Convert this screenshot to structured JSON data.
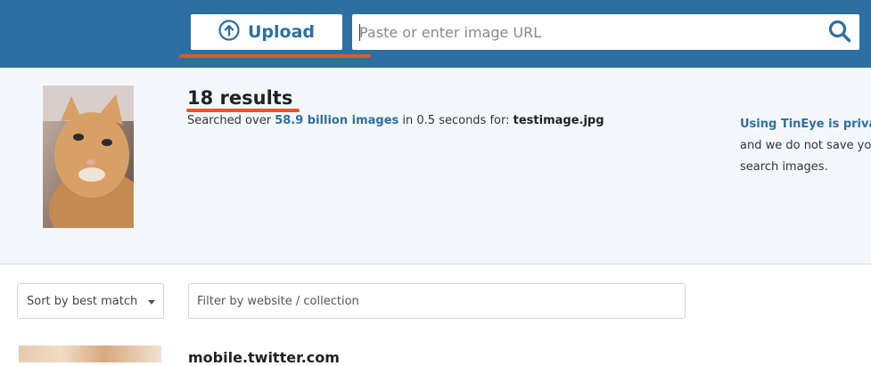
{
  "header": {
    "upload_label": "Upload",
    "search_placeholder": "Paste or enter image URL",
    "search_value": "",
    "colors": {
      "header_bg": "#2e6fa2",
      "accent_underline": "#e8571f"
    }
  },
  "summary": {
    "results_count": "18 results",
    "searched_prefix": "Searched over",
    "searched_link": "58.9 billion images",
    "searched_mid": "in 0.5 seconds for:",
    "filename": "testimage.jpg",
    "privacy_link": "Using TinEye is private",
    "privacy_line2": "and we do not save you",
    "privacy_line3": "search images."
  },
  "controls": {
    "sort_selected": "Sort by best match",
    "filter_placeholder": "Filter by website / collection"
  },
  "results": [
    {
      "domain": "mobile.twitter.com"
    }
  ],
  "icons": {
    "upload": "upload-arrow-circle-icon",
    "search": "search-icon",
    "sort_chevron": "chevron-down-icon"
  }
}
